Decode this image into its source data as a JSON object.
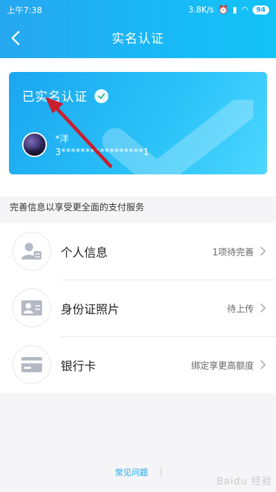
{
  "status_bar": {
    "time": "上午7:38",
    "speed": "3.8K/s",
    "battery": "94"
  },
  "header": {
    "title": "实名认证"
  },
  "card": {
    "status": "已实名认证",
    "name": "*洋",
    "id_number": "3*****************1"
  },
  "hint": "完善信息以享受更全面的支付服务",
  "items": [
    {
      "label": "个人信息",
      "meta": "1项待完善"
    },
    {
      "label": "身份证照片",
      "meta": "待上传"
    },
    {
      "label": "银行卡",
      "meta": "绑定享更高额度"
    }
  ],
  "footer": {
    "faq": "常见问题"
  },
  "watermark": "Baidu 经验"
}
